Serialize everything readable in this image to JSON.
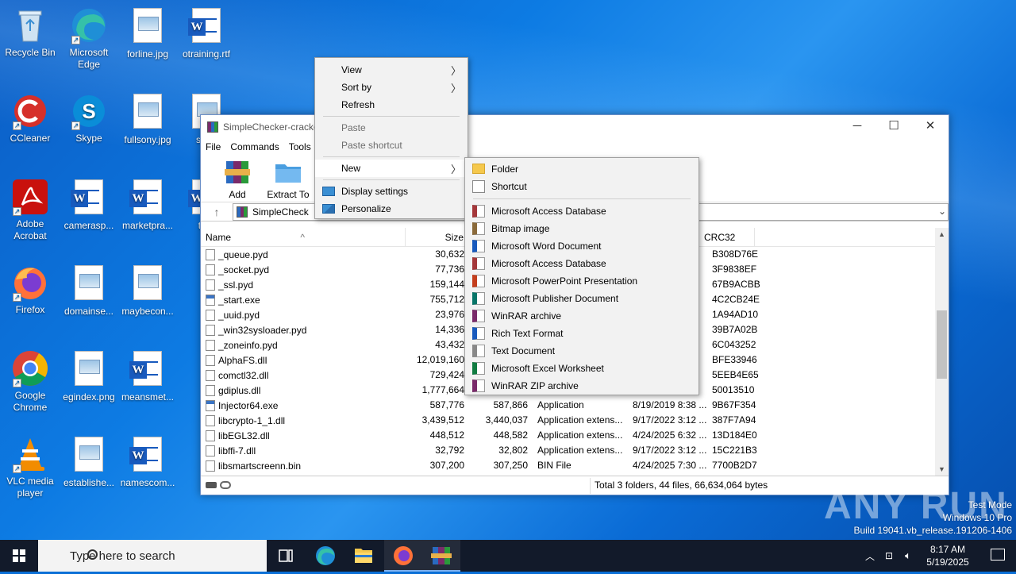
{
  "desktop": {
    "icons": [
      {
        "label": "Recycle Bin",
        "icon": "recycle-bin-icon"
      },
      {
        "label": "Microsoft Edge",
        "icon": "edge-icon"
      },
      {
        "label": "forline.jpg",
        "icon": "image-file-icon"
      },
      {
        "label": "otraining.rtf",
        "icon": "word-doc-icon"
      },
      {
        "label": "CCleaner",
        "icon": "ccleaner-icon"
      },
      {
        "label": "Skype",
        "icon": "skype-icon"
      },
      {
        "label": "fullsony.jpg",
        "icon": "image-file-icon"
      },
      {
        "label": "state",
        "icon": "image-file-icon"
      },
      {
        "label": "Adobe Acrobat",
        "icon": "acrobat-icon"
      },
      {
        "label": "camerasp...",
        "icon": "word-doc-icon"
      },
      {
        "label": "marketpra...",
        "icon": "word-doc-icon"
      },
      {
        "label": "traff",
        "icon": "word-doc-icon"
      },
      {
        "label": "Firefox",
        "icon": "firefox-icon"
      },
      {
        "label": "domainse...",
        "icon": "image-file-icon"
      },
      {
        "label": "maybecon...",
        "icon": "image-file-icon"
      },
      {
        "label": "Google Chrome",
        "icon": "chrome-icon"
      },
      {
        "label": "egindex.png",
        "icon": "image-file-icon"
      },
      {
        "label": "meansmet...",
        "icon": "word-doc-icon"
      },
      {
        "label": "VLC media player",
        "icon": "vlc-icon"
      },
      {
        "label": "establishe...",
        "icon": "image-file-icon"
      },
      {
        "label": "namescom...",
        "icon": "word-doc-icon"
      }
    ]
  },
  "winrar": {
    "title": "SimpleChecker-cracke",
    "menu": [
      "File",
      "Commands",
      "Tools"
    ],
    "toolbar": [
      "Add",
      "Extract To"
    ],
    "address": "SimpleCheck",
    "columns": [
      "Name",
      "Size",
      "CRC32"
    ],
    "rows": [
      {
        "name": "_queue.pyd",
        "size": "30,632",
        "packed": "",
        "type": "",
        "modified": "",
        "crc": "B308D76E"
      },
      {
        "name": "_socket.pyd",
        "size": "77,736",
        "packed": "",
        "type": "",
        "modified": "",
        "crc": "3F9838EF"
      },
      {
        "name": "_ssl.pyd",
        "size": "159,144",
        "packed": "",
        "type": "",
        "modified": "",
        "crc": "67B9ACBB"
      },
      {
        "name": "_start.exe",
        "size": "755,712",
        "packed": "",
        "type": "",
        "modified": "",
        "crc": "4C2CB24E"
      },
      {
        "name": "_uuid.pyd",
        "size": "23,976",
        "packed": "",
        "type": "",
        "modified": "",
        "crc": "1A94AD10"
      },
      {
        "name": "_win32sysloader.pyd",
        "size": "14,336",
        "packed": "",
        "type": "",
        "modified": "",
        "crc": "39B7A02B"
      },
      {
        "name": "_zoneinfo.pyd",
        "size": "43,432",
        "packed": "",
        "type": "",
        "modified": "",
        "crc": "6C043252"
      },
      {
        "name": "AlphaFS.dll",
        "size": "12,019,160",
        "packed": "",
        "type": "",
        "modified": "",
        "crc": "BFE33946"
      },
      {
        "name": "comctl32.dll",
        "size": "729,424",
        "packed": "",
        "type": "",
        "modified": "",
        "crc": "5EEB4E65"
      },
      {
        "name": "gdiplus.dll",
        "size": "1,777,664",
        "packed": "",
        "type": "",
        "modified": "",
        "crc": "50013510"
      },
      {
        "name": "Injector64.exe",
        "size": "587,776",
        "packed": "587,866",
        "type": "Application",
        "modified": "8/19/2019 8:38 ...",
        "crc": "9B67F354"
      },
      {
        "name": "libcrypto-1_1.dll",
        "size": "3,439,512",
        "packed": "3,440,037",
        "type": "Application extens...",
        "modified": "9/17/2022 3:12 ...",
        "crc": "387F7A94"
      },
      {
        "name": "libEGL32.dll",
        "size": "448,512",
        "packed": "448,582",
        "type": "Application extens...",
        "modified": "4/24/2025 6:32 ...",
        "crc": "13D184E0"
      },
      {
        "name": "libffi-7.dll",
        "size": "32,792",
        "packed": "32,802",
        "type": "Application extens...",
        "modified": "9/17/2022 3:12 ...",
        "crc": "15C221B3"
      },
      {
        "name": "libsmartscreenn.bin",
        "size": "307,200",
        "packed": "307,250",
        "type": "BIN File",
        "modified": "4/24/2025 7:30 ...",
        "crc": "7700B2D7"
      }
    ],
    "status": "Total 3 folders, 44 files, 66,634,064 bytes"
  },
  "context_menu": {
    "view": "View",
    "sort_by": "Sort by",
    "refresh": "Refresh",
    "paste": "Paste",
    "paste_shortcut": "Paste shortcut",
    "new": "New",
    "display_settings": "Display settings",
    "personalize": "Personalize"
  },
  "new_submenu": {
    "folder": "Folder",
    "shortcut": "Shortcut",
    "items": [
      {
        "label": "Microsoft Access Database",
        "color": "#a4373a"
      },
      {
        "label": "Bitmap image",
        "color": "#8a6a3a"
      },
      {
        "label": "Microsoft Word Document",
        "color": "#185abd"
      },
      {
        "label": "Microsoft Access Database",
        "color": "#a4373a"
      },
      {
        "label": "Microsoft PowerPoint Presentation",
        "color": "#c43e1c"
      },
      {
        "label": "Microsoft Publisher Document",
        "color": "#077568"
      },
      {
        "label": "WinRAR archive",
        "color": "#7a2a6a"
      },
      {
        "label": "Rich Text Format",
        "color": "#185abd"
      },
      {
        "label": "Text Document",
        "color": "#888888"
      },
      {
        "label": "Microsoft Excel Worksheet",
        "color": "#107c41"
      },
      {
        "label": "WinRAR ZIP archive",
        "color": "#7a2a6a"
      }
    ]
  },
  "taskbar": {
    "search_placeholder": "Type here to search",
    "time": "8:17 AM",
    "date": "5/19/2025"
  },
  "watermark": {
    "brand": "ANY RUN",
    "line1": "Test Mode",
    "line2": "Windows 10 Pro",
    "line3": "Build 19041.vb_release.191206-1406"
  }
}
